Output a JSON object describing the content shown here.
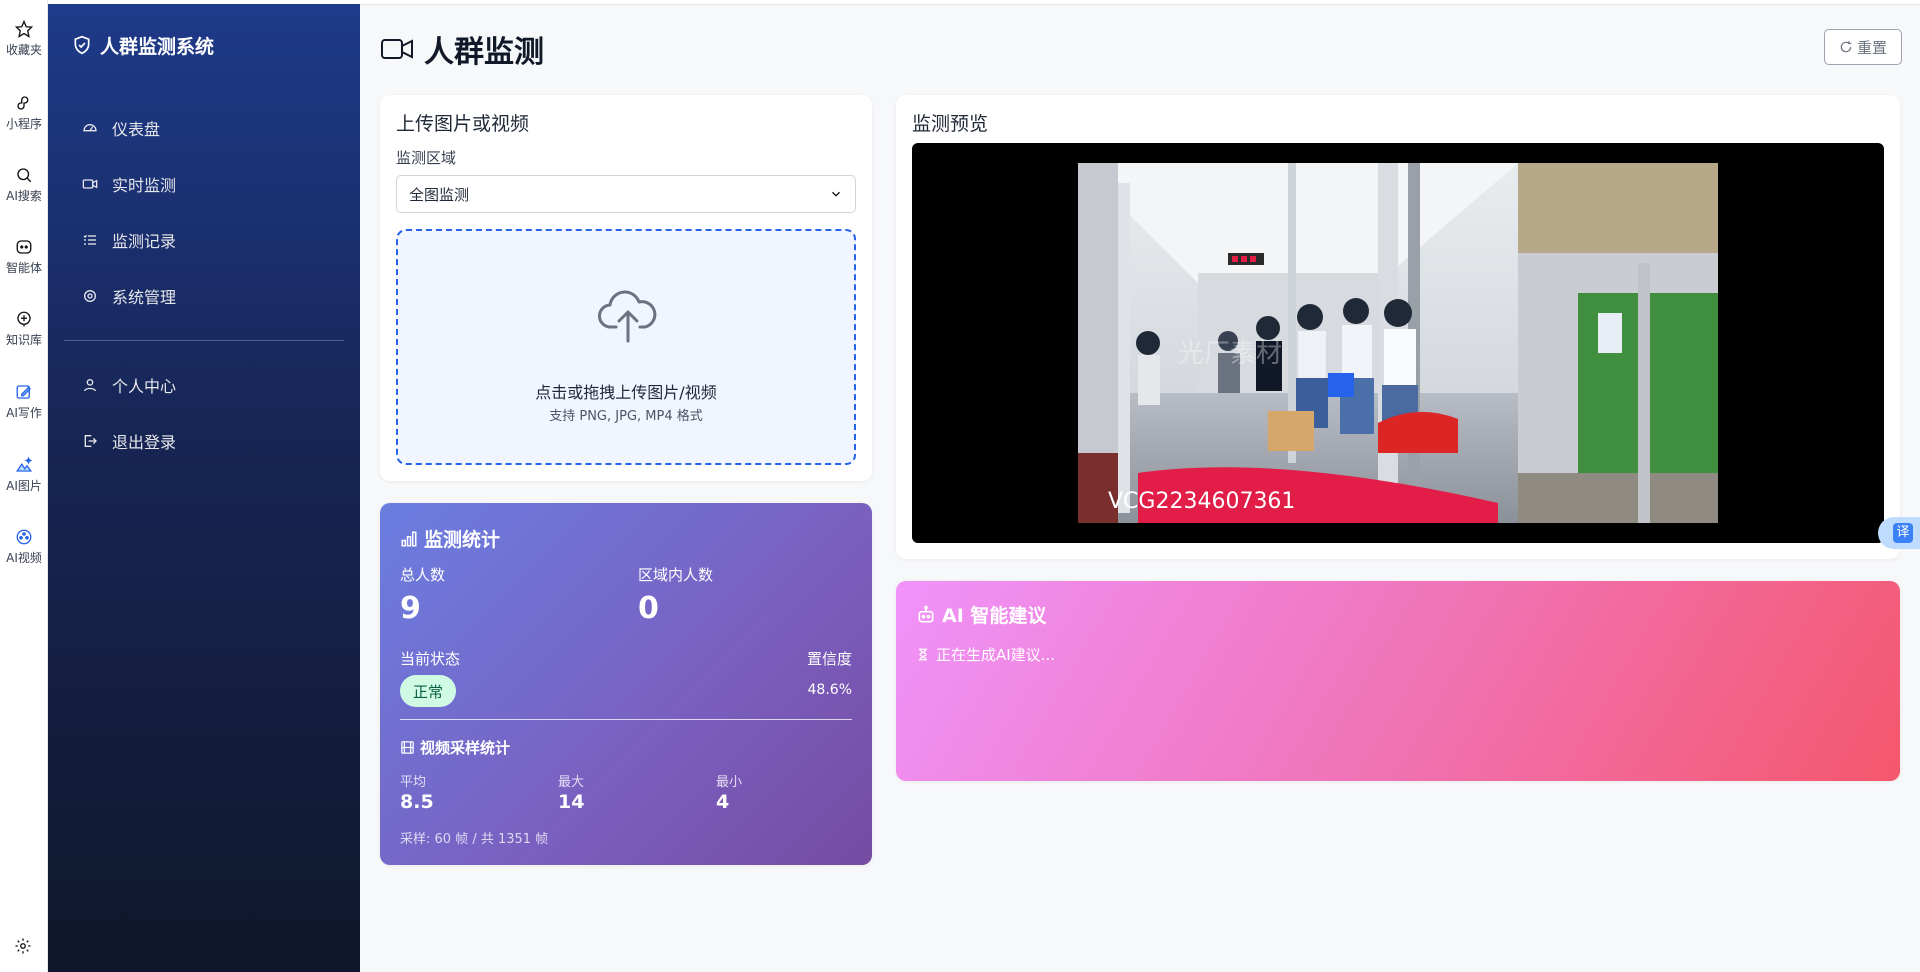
{
  "browser_rail": {
    "items": [
      {
        "label": "收藏夹",
        "icon": "star-icon"
      },
      {
        "label": "小程序",
        "icon": "mini-program-icon"
      },
      {
        "label": "AI搜索",
        "icon": "search-icon"
      },
      {
        "label": "智能体",
        "icon": "agent-icon"
      },
      {
        "label": "知识库",
        "icon": "knowledge-icon"
      },
      {
        "label": "AI写作",
        "icon": "write-icon"
      },
      {
        "label": "AI图片",
        "icon": "image-icon"
      },
      {
        "label": "AI视频",
        "icon": "video-icon"
      }
    ]
  },
  "sidebar": {
    "brand": "人群监测系统",
    "nav": [
      {
        "label": "仪表盘",
        "icon": "dashboard-icon"
      },
      {
        "label": "实时监测",
        "icon": "camera-icon"
      },
      {
        "label": "监测记录",
        "icon": "list-icon"
      },
      {
        "label": "系统管理",
        "icon": "gear-icon"
      }
    ],
    "nav_bottom": [
      {
        "label": "个人中心",
        "icon": "user-icon"
      },
      {
        "label": "退出登录",
        "icon": "logout-icon"
      }
    ]
  },
  "header": {
    "title": "人群监测",
    "reset_label": "重置"
  },
  "upload": {
    "title": "上传图片或视频",
    "region_label": "监测区域",
    "region_value": "全图监测",
    "drop_text": "点击或拖拽上传图片/视频",
    "drop_hint": "支持 PNG, JPG, MP4 格式"
  },
  "stats": {
    "title": "监测统计",
    "total_label": "总人数",
    "total_value": "9",
    "region_label": "区域内人数",
    "region_value": "0",
    "status_label": "当前状态",
    "status_value": "正常",
    "confidence_label": "置信度",
    "confidence_value": "48.6%",
    "video_title": "视频采样统计",
    "avg_label": "平均",
    "avg_value": "8.5",
    "max_label": "最大",
    "max_value": "14",
    "min_label": "最小",
    "min_value": "4",
    "sample_text": "采样: 60 帧 / 共 1351 帧"
  },
  "preview": {
    "title": "监测预览",
    "watermark_code": "VCG2234607361",
    "watermark_brand": "光厂素材"
  },
  "ai": {
    "title": "AI 智能建议",
    "status": "正在生成AI建议..."
  },
  "translate": {
    "label": "译"
  },
  "colors": {
    "sidebar_top": "#1e3a8a",
    "sidebar_bottom": "#0f172a",
    "stats_gradient_start": "#6a7ee0",
    "stats_gradient_end": "#764ba2",
    "ai_gradient_start": "#f093fb",
    "ai_gradient_end": "#f5576c",
    "accent": "#2563eb"
  }
}
